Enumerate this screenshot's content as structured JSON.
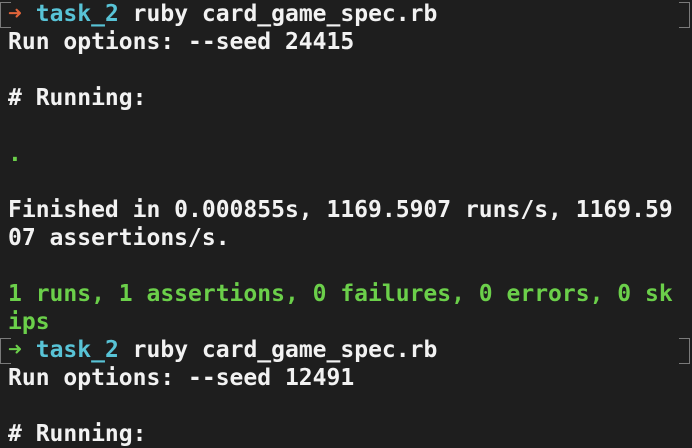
{
  "prompt_arrow": "➜",
  "runs": [
    {
      "status": "failed-previous",
      "dir": "task_2",
      "command": "ruby card_game_spec.rb",
      "options": "Run options: --seed 24415",
      "running": "# Running:",
      "progress": ".",
      "finished_1": "Finished in 0.000855s, 1169.5907 runs/s, 1169.59",
      "finished_2": "07 assertions/s.",
      "summary_1": "1 runs, 1 assertions, 0 failures, 0 errors, 0 sk",
      "summary_2": "ips"
    },
    {
      "status": "success-previous",
      "dir": "task_2",
      "command": "ruby card_game_spec.rb",
      "options": "Run options: --seed 12491",
      "running": "# Running:"
    }
  ],
  "colors": {
    "background": "#1e1e1e",
    "text": "#f2f2f2",
    "prompt_error": "#e0643a",
    "prompt_success": "#6bcf4a",
    "directory": "#58c3d6",
    "pass": "#6bcf4a"
  }
}
